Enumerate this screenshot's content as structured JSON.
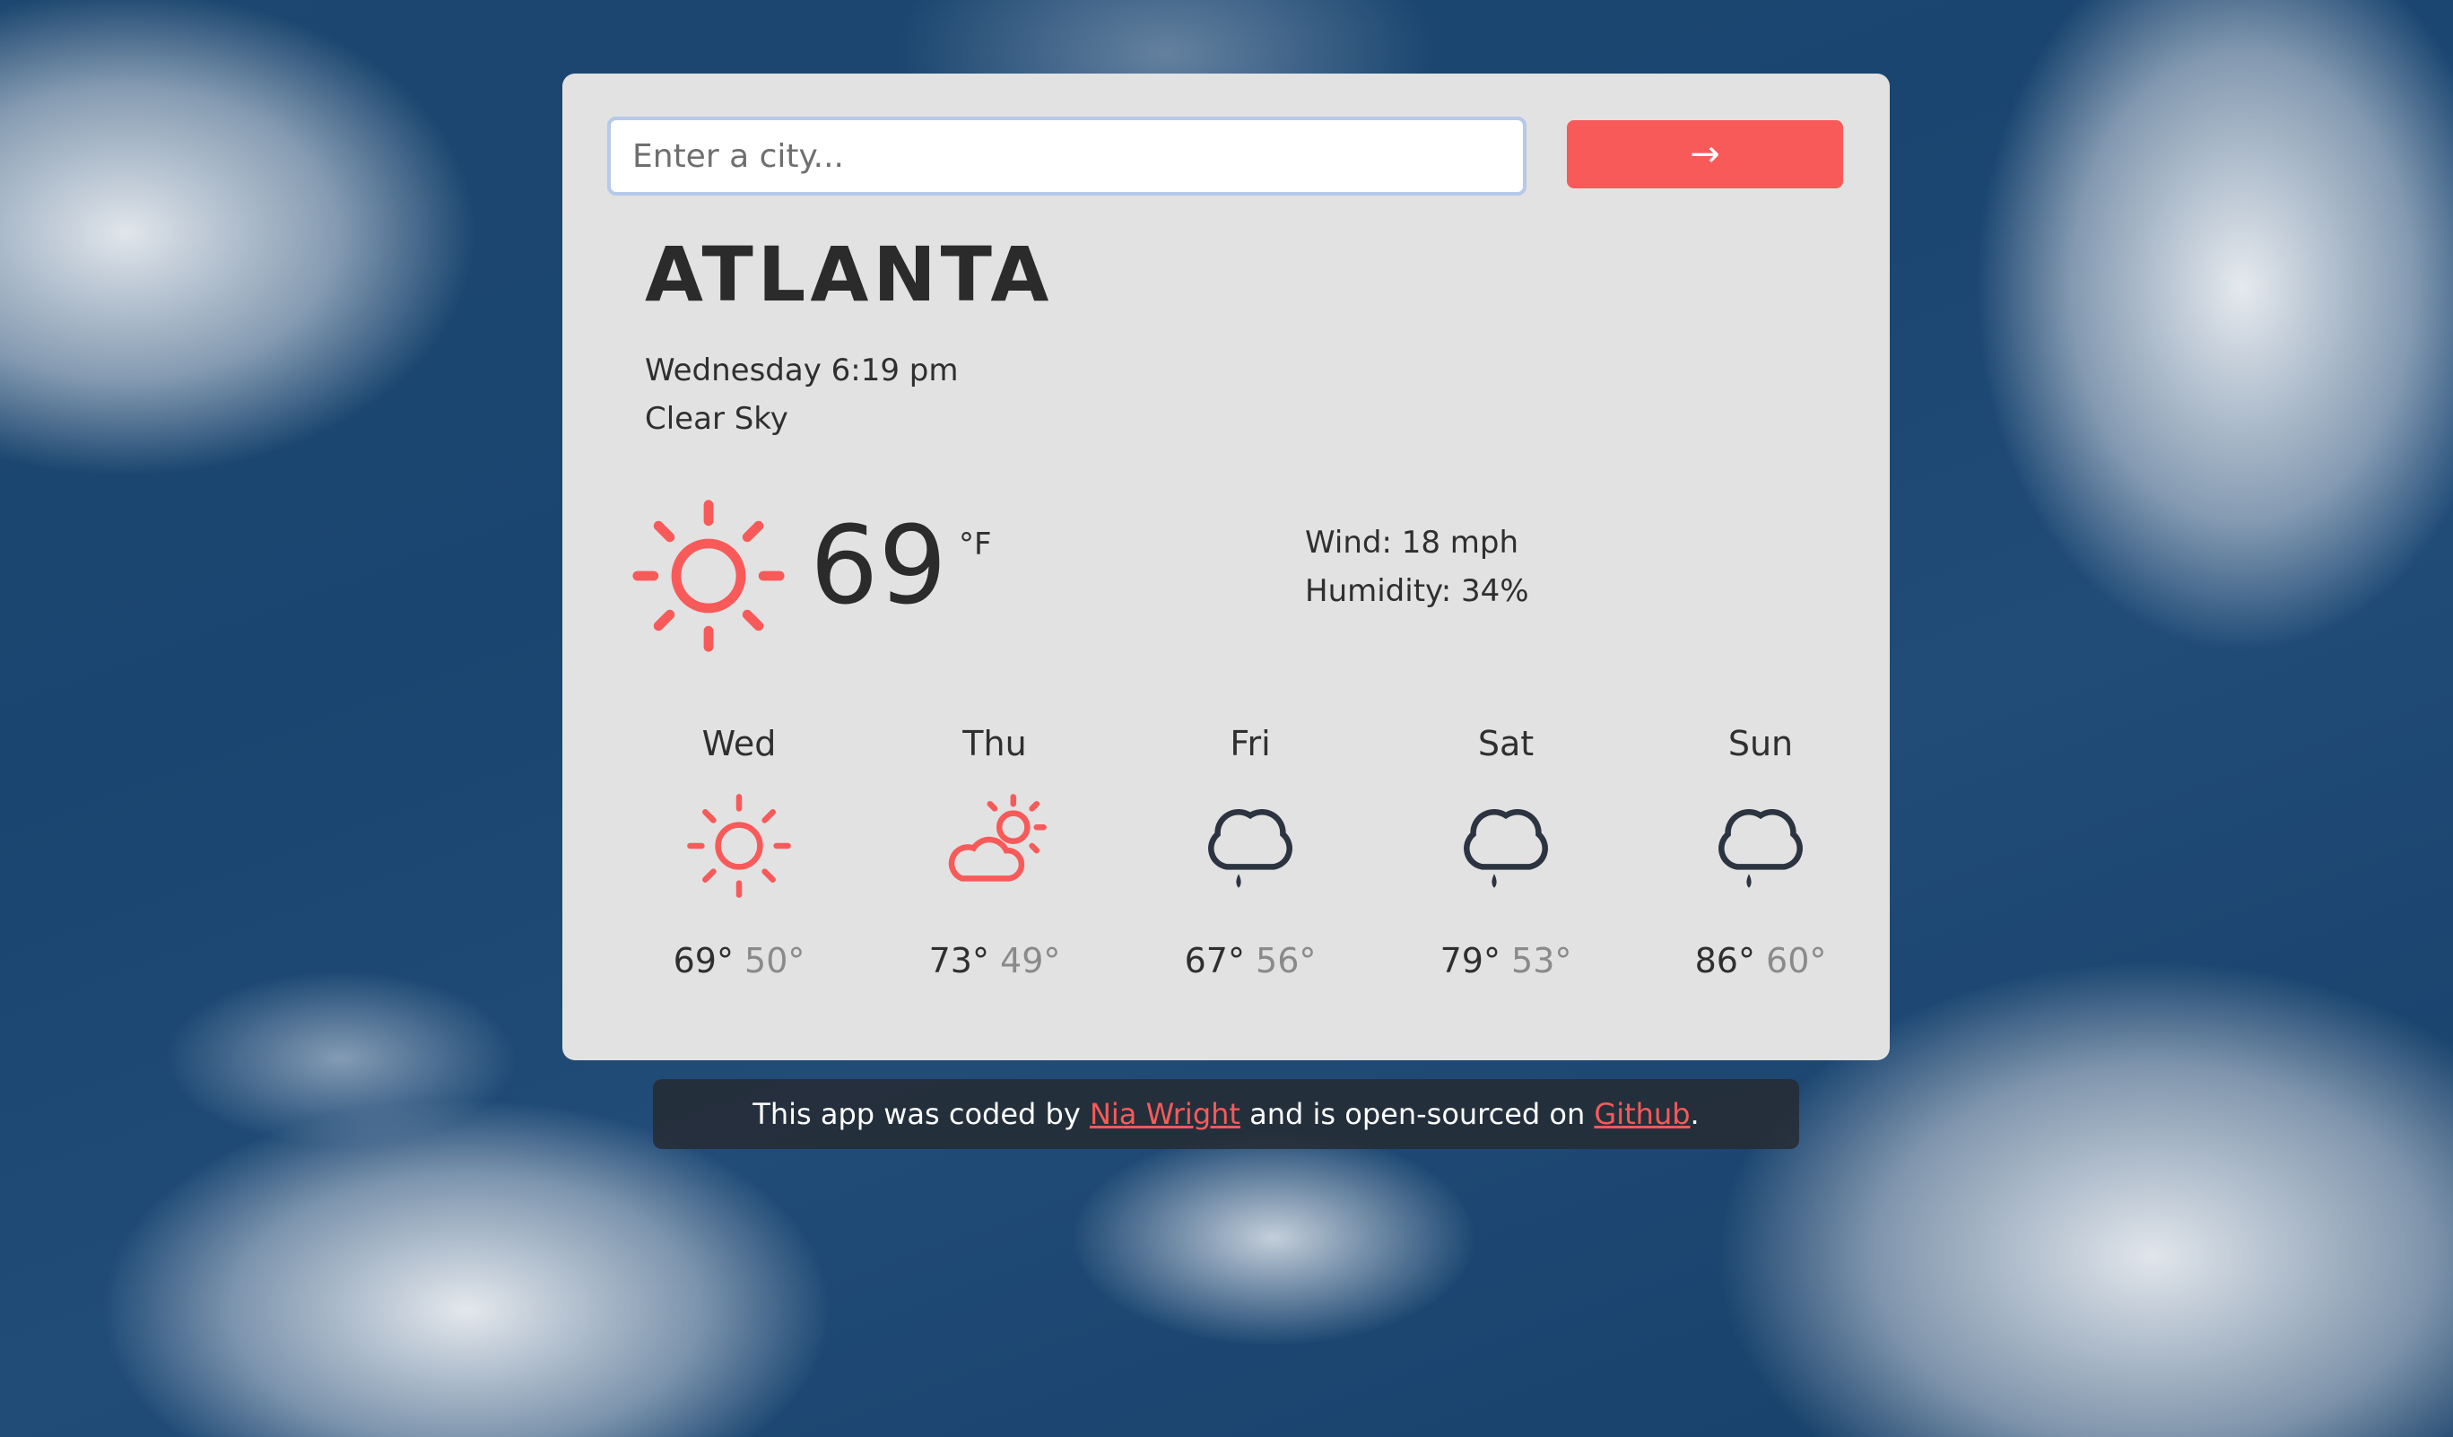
{
  "search": {
    "placeholder": "Enter a city...",
    "value": "",
    "button_label": "→"
  },
  "current": {
    "city": "ATLANTA",
    "datetime": "Wednesday 6:19 pm",
    "condition": "Clear Sky",
    "icon": "sun-icon",
    "temperature": "69",
    "unit": "°F",
    "wind": "Wind: 18 mph",
    "humidity": "Humidity: 34%"
  },
  "forecast": [
    {
      "day": "Wed",
      "icon": "sun-icon",
      "high": "69°",
      "low": "50°"
    },
    {
      "day": "Thu",
      "icon": "partly-cloudy-icon",
      "high": "73°",
      "low": "49°"
    },
    {
      "day": "Fri",
      "icon": "rain-cloud-icon",
      "high": "67°",
      "low": "56°"
    },
    {
      "day": "Sat",
      "icon": "rain-cloud-icon",
      "high": "79°",
      "low": "53°"
    },
    {
      "day": "Sun",
      "icon": "rain-cloud-icon",
      "high": "86°",
      "low": "60°"
    }
  ],
  "footer": {
    "prefix": "This app was coded by ",
    "author": "Nia Wright",
    "middle": " and is open-sourced on ",
    "repo": "Github",
    "suffix": "."
  },
  "colors": {
    "accent": "#f85a5a",
    "card": "#e2e2e2",
    "icon_dark": "#2b3440"
  }
}
